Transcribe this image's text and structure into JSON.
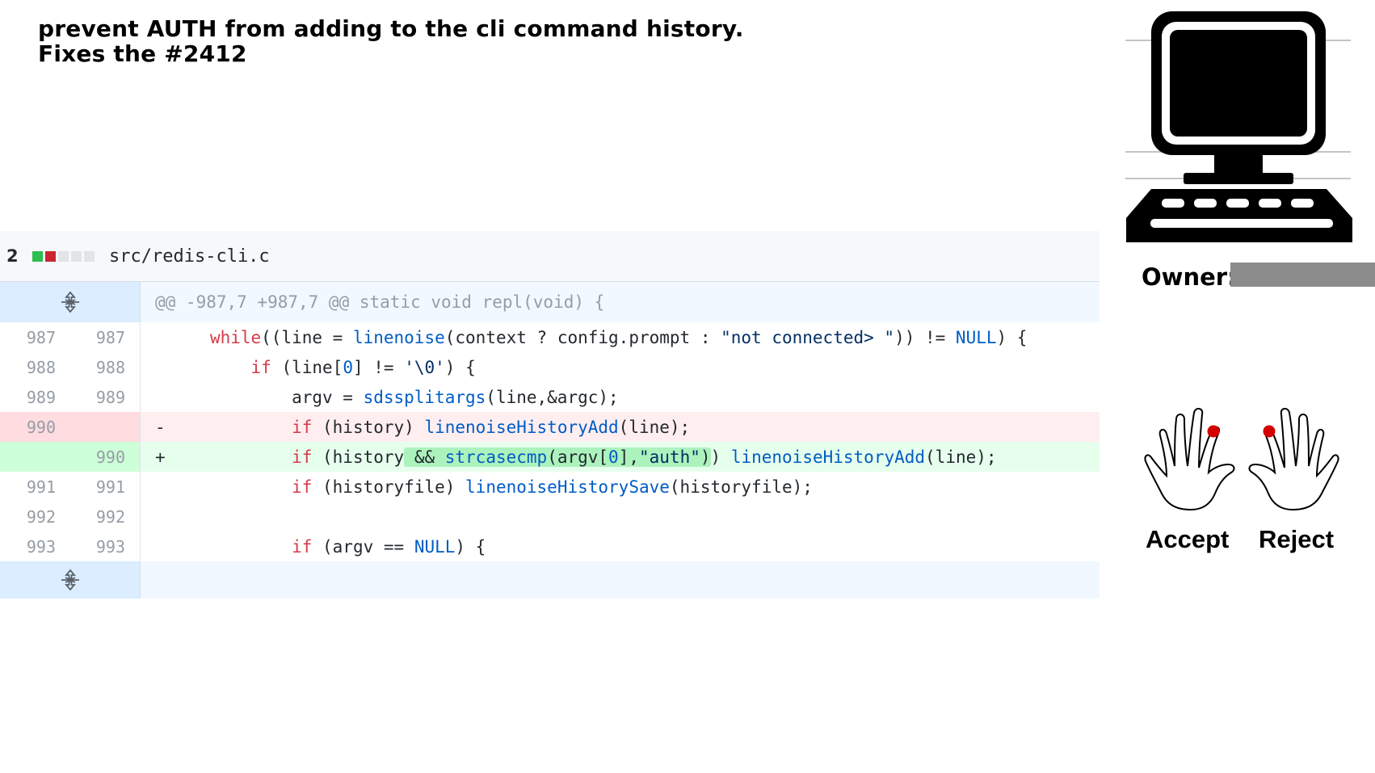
{
  "title": "prevent AUTH from adding to the cli command history. Fixes the #2412",
  "file": {
    "changes": "2",
    "name": "src/redis-cli.c",
    "stat": [
      "added",
      "removed",
      "neutral",
      "neutral",
      "neutral"
    ]
  },
  "hunk_header": "@@ -987,7 +987,7 @@ static void repl(void) {",
  "lines": [
    {
      "old": "987",
      "new": "987",
      "type": "context",
      "marker": ""
    },
    {
      "old": "988",
      "new": "988",
      "type": "context",
      "marker": ""
    },
    {
      "old": "989",
      "new": "989",
      "type": "context",
      "marker": ""
    },
    {
      "old": "990",
      "new": "",
      "type": "del",
      "marker": "-"
    },
    {
      "old": "",
      "new": "990",
      "type": "add",
      "marker": "+"
    },
    {
      "old": "991",
      "new": "991",
      "type": "context",
      "marker": ""
    },
    {
      "old": "992",
      "new": "992",
      "type": "context",
      "marker": ""
    },
    {
      "old": "993",
      "new": "993",
      "type": "context",
      "marker": ""
    }
  ],
  "owner_label": "Owner:",
  "accept_label": "Accept",
  "reject_label": "Reject",
  "colors": {
    "added": "#2cbe4e",
    "removed": "#cb2431",
    "del_bg": "#ffeef0",
    "add_bg": "#e6ffed",
    "highlight": "#acf2bd",
    "owner_redacted": "#8c8c8c",
    "fingertip": "#d40000"
  },
  "icons": [
    "computer-terminal-icon",
    "expand-up-icon",
    "expand-down-icon",
    "left-hand-icon",
    "right-hand-icon"
  ]
}
